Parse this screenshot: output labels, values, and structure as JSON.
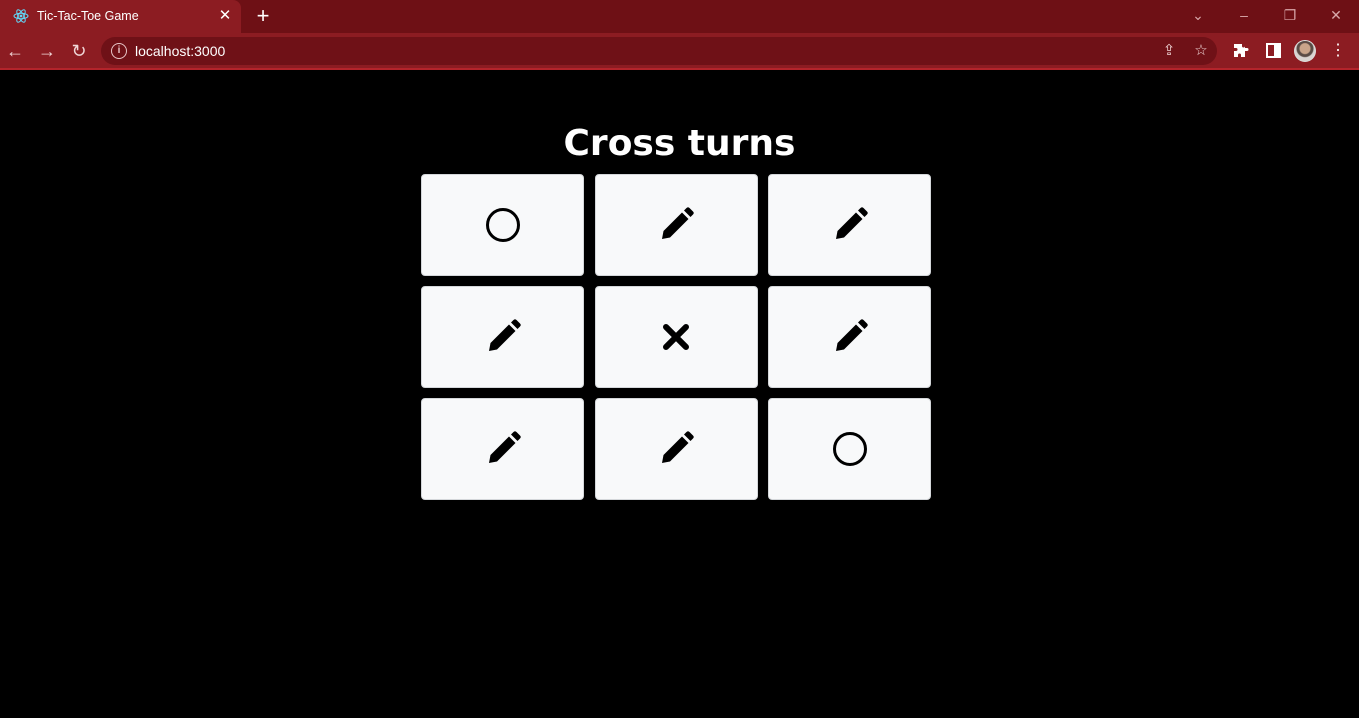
{
  "browser": {
    "tab_title": "Tic-Tac-Toe Game",
    "url": "localhost:3000",
    "theme": {
      "titlebar": "#6e1015",
      "toolbar": "#8c1c22",
      "omnibox": "#6f1117"
    }
  },
  "game": {
    "status": "Cross turns",
    "cells": [
      "circle",
      "pencil",
      "pencil",
      "pencil",
      "cross",
      "pencil",
      "pencil",
      "pencil",
      "circle"
    ]
  }
}
